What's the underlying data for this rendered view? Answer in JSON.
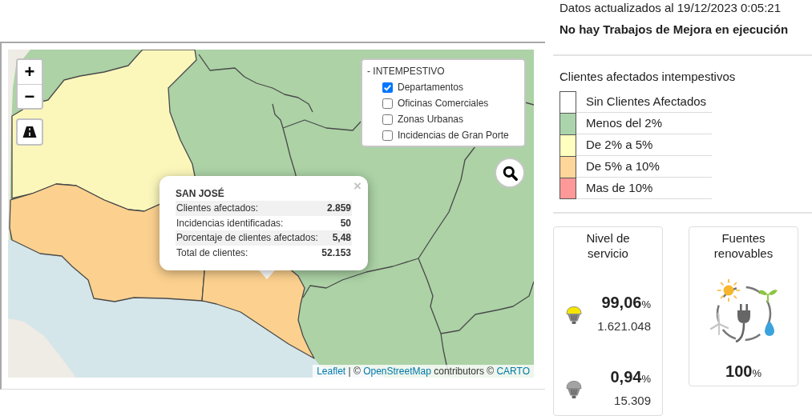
{
  "map": {
    "zoom_in": "+",
    "zoom_out": "−",
    "layers": {
      "title": "- INTEMPESTIVO",
      "items": [
        {
          "label": "Departamentos",
          "checked": true
        },
        {
          "label": "Oficinas Comerciales",
          "checked": false
        },
        {
          "label": "Zonas Urbanas",
          "checked": false
        },
        {
          "label": "Incidencias de Gran Porte",
          "checked": false
        }
      ]
    },
    "popup": {
      "title": "SAN JOSÉ",
      "close": "×",
      "rows": [
        {
          "label": "Clientes afectados:",
          "value": "2.859"
        },
        {
          "label": "Incidencias identificadas:",
          "value": "50"
        },
        {
          "label": "Porcentaje de clientes afectados:",
          "value": "5,48"
        },
        {
          "label": "Total de clientes:",
          "value": "52.153"
        }
      ]
    },
    "attribution": [
      {
        "text": "Leaflet",
        "link": true
      },
      {
        "text": " | © ",
        "link": false
      },
      {
        "text": "OpenStreetMap",
        "link": true
      },
      {
        "text": " contributors © ",
        "link": false
      },
      {
        "text": "CARTO",
        "link": true
      }
    ]
  },
  "header": {
    "updated": "Datos actualizados al 19/12/2023 0:05:21",
    "works": "No hay Trabajos de Mejora en ejecución"
  },
  "legend": {
    "title": "Clientes afectados intempestivos",
    "items": [
      {
        "label": "Sin Clientes Afectados",
        "color": "#ffffff"
      },
      {
        "label": "Menos del 2%",
        "color": "#acd4ac"
      },
      {
        "label": "De 2% a 5%",
        "color": "#ffffc0"
      },
      {
        "label": "De 5% a 10%",
        "color": "#ffd699"
      },
      {
        "label": "Mas de 10%",
        "color": "#ff9999"
      }
    ]
  },
  "service": {
    "title": "Nivel de servicio",
    "rows": [
      {
        "lit": true,
        "value": "99,06",
        "unit": "%",
        "count": "1.621.048"
      },
      {
        "lit": false,
        "value": "0,94",
        "unit": "%",
        "count": "15.309"
      }
    ]
  },
  "renewables": {
    "title": "Fuentes renovables",
    "value": "100",
    "unit": "%"
  }
}
